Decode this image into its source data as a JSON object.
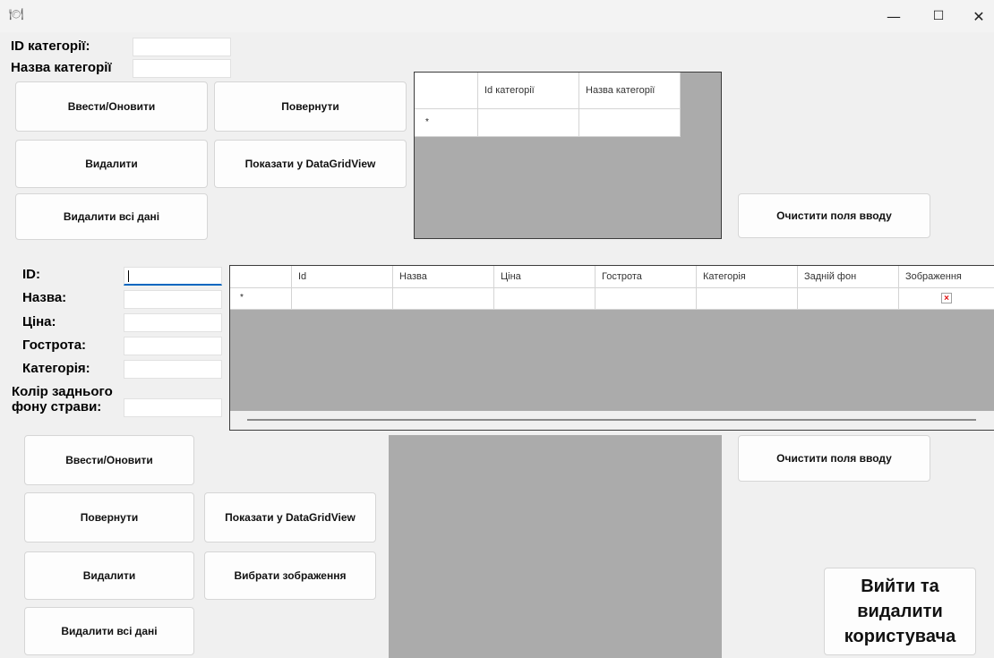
{
  "window": {
    "icon": "food-icon",
    "controls": {
      "minimize": "—",
      "maximize": "☐",
      "close": "✕"
    }
  },
  "category_form": {
    "id_label": "ID категорії:",
    "name_label": "Назва категорії",
    "id_value": "",
    "name_value": ""
  },
  "category_buttons": {
    "save": "Ввести/Оновити",
    "restore": "Повернути",
    "delete": "Видалити",
    "show_grid": "Показати у DataGridView",
    "delete_all": "Видалити всі дані",
    "clear": "Очистити поля вводу"
  },
  "category_grid": {
    "columns": [
      "Id категорії",
      "Назва категорії"
    ],
    "new_row_marker": "*"
  },
  "dish_form": {
    "id_label": "ID:",
    "name_label": "Назва:",
    "price_label": "Ціна:",
    "spiciness_label": "Гострота:",
    "category_label": "Категорія:",
    "bg_label_line1": "Колір заднього",
    "bg_label_line2": "фону страви:"
  },
  "dish_grid": {
    "columns": [
      "Id",
      "Назва",
      "Ціна",
      "Гострота",
      "Категорія",
      "Задній фон",
      "Зображення"
    ],
    "new_row_marker": "*",
    "image_placeholder": "×"
  },
  "dish_buttons": {
    "save": "Ввести/Оновити",
    "restore": "Повернути",
    "show_grid": "Показати у DataGridView",
    "delete": "Видалити",
    "choose_image": "Вибрати зображення",
    "delete_all": "Видалити всі дані",
    "clear": "Очистити поля вводу"
  },
  "exit_button": {
    "line1": "Вийти та",
    "line2": "видалити",
    "line3": "користувача"
  },
  "colors": {
    "grid_background": "#ababab",
    "focus_accent": "#0067c0",
    "window_background": "#f0f0f0"
  }
}
